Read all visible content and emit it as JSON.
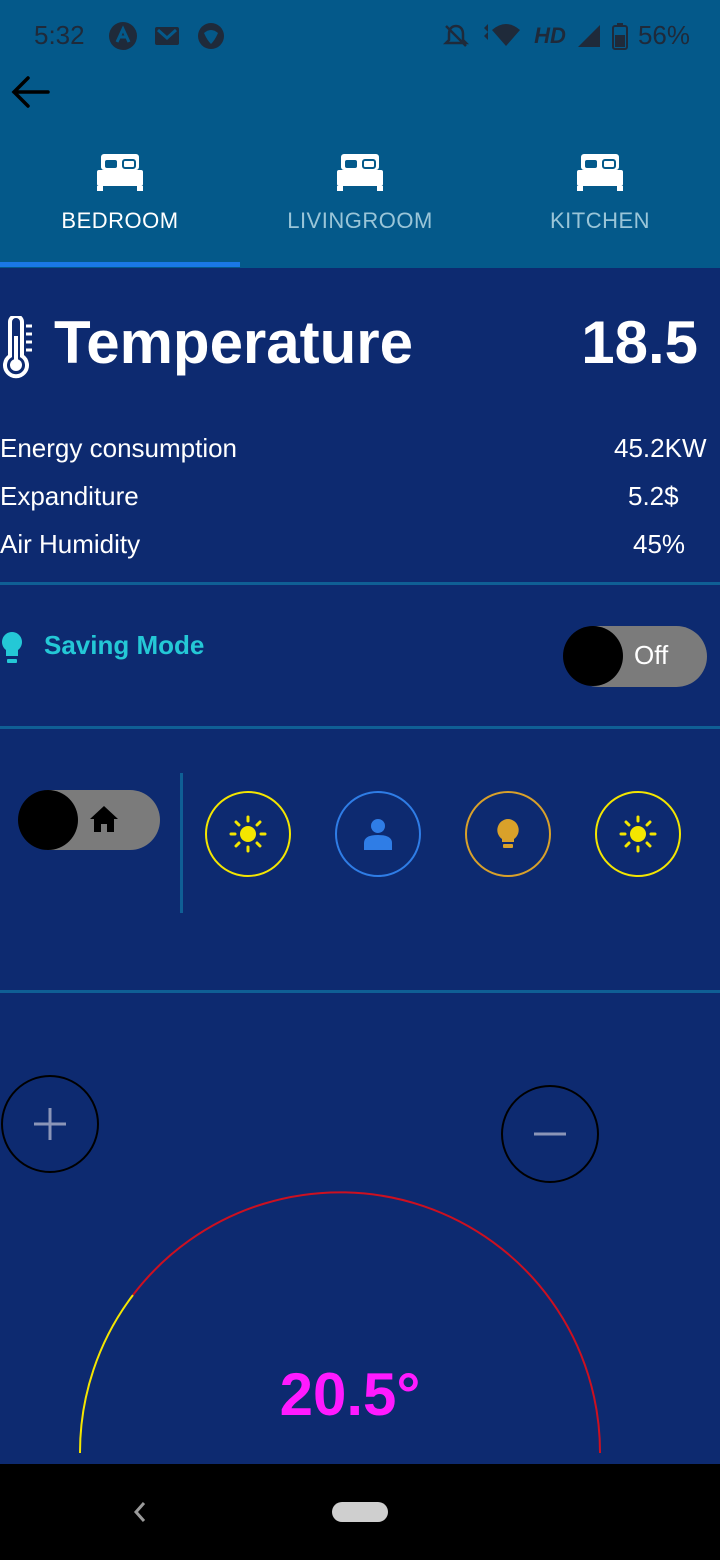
{
  "status_bar": {
    "time": "5:32",
    "network": "HD",
    "battery": "56%",
    "icons": [
      "notification-a-icon",
      "gmail-icon",
      "browser-icon",
      "mute-icon",
      "wifi-icon",
      "signal-icon",
      "battery-icon"
    ]
  },
  "tabs": [
    {
      "label": "BEDROOM",
      "icon": "bed-icon",
      "active": true
    },
    {
      "label": "LIVINGROOM",
      "icon": "bed-icon",
      "active": false
    },
    {
      "label": "KITCHEN",
      "icon": "bed-icon",
      "active": false
    }
  ],
  "temperature": {
    "title": "Temperature",
    "value": "18.5",
    "icon": "thermometer-icon"
  },
  "stats": [
    {
      "label": "Energy consumption",
      "value": "45.2KW"
    },
    {
      "label": "Expanditure",
      "value": "5.2$"
    },
    {
      "label": "Air Humidity",
      "value": "45%"
    }
  ],
  "saving_mode": {
    "label": "Saving Mode",
    "toggle_text": "Off",
    "icon": "bulb-icon"
  },
  "mode_buttons": [
    {
      "name": "home-toggle",
      "icon": "home-icon"
    },
    {
      "name": "sun-mode-button",
      "icon": "sun-icon",
      "color": "#f4e600"
    },
    {
      "name": "person-mode-button",
      "icon": "person-icon",
      "color": "#2f7de6"
    },
    {
      "name": "bulb-mode-button",
      "icon": "bulb-icon",
      "color": "#d9a12a"
    },
    {
      "name": "sun-mode-button-2",
      "icon": "sun-icon",
      "color": "#f4e600"
    }
  ],
  "thermostat": {
    "set_value": "20.5°",
    "arc_low_color": "#f4e600",
    "arc_high_color": "#cc1020"
  },
  "colors": {
    "accent": "#1a78e6",
    "app_bar": "#04598a",
    "background": "#0d2a70",
    "saving_text": "#24c8d6",
    "set_temp": "#ff1aff"
  }
}
